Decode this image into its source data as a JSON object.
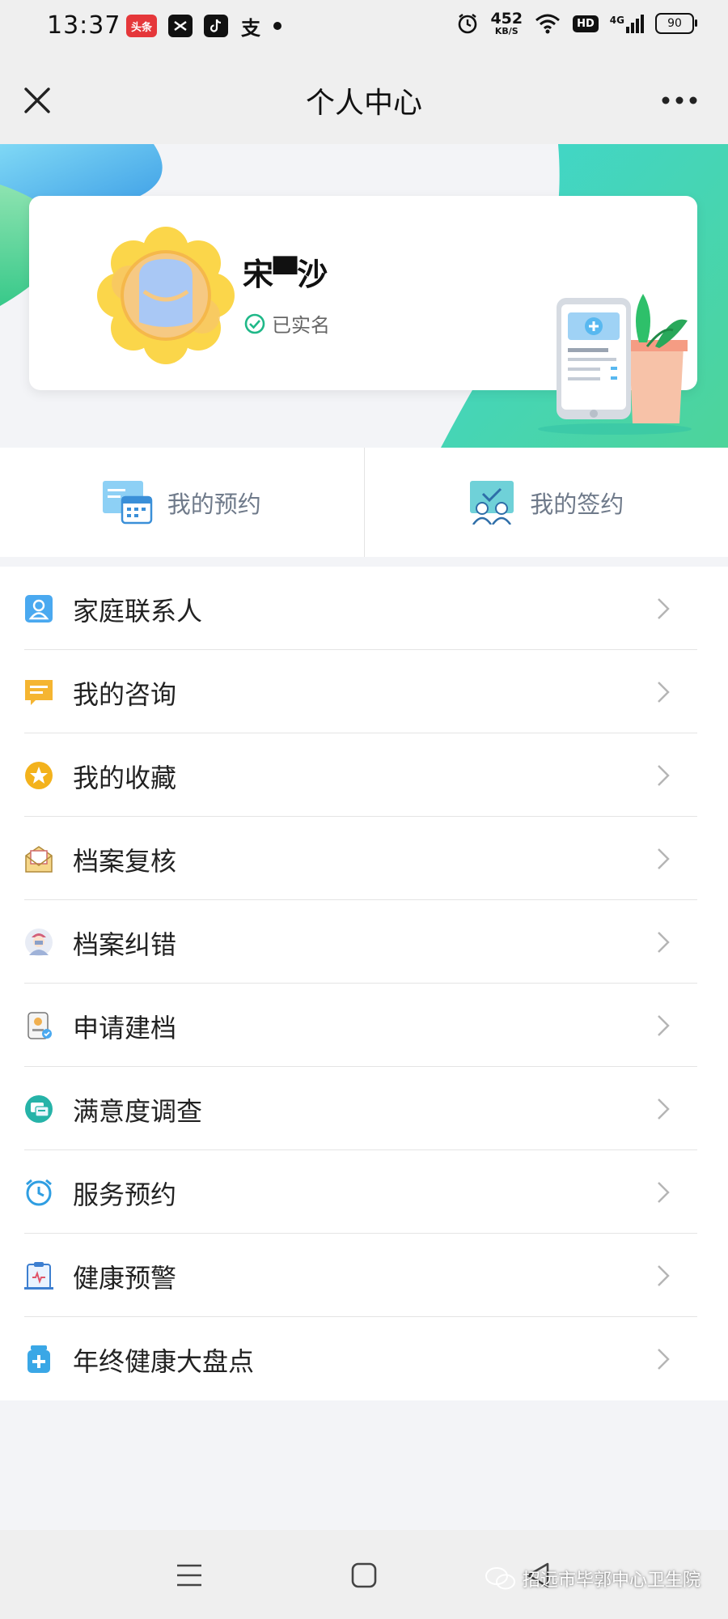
{
  "status_bar": {
    "time": "13:37",
    "apps": [
      "头条",
      "tiktok",
      "capcut",
      "支"
    ],
    "net_speed": "452",
    "net_unit": "KB/S",
    "hd": "HD",
    "signal": "4G",
    "battery": "90"
  },
  "header": {
    "title": "个人中心"
  },
  "profile": {
    "name": "宋▀沙",
    "verified_label": "已实名"
  },
  "quick_actions": [
    {
      "label": "我的预约",
      "icon": "calendar-icon"
    },
    {
      "label": "我的签约",
      "icon": "contract-icon"
    }
  ],
  "menu": [
    {
      "label": "家庭联系人",
      "icon": "contact-icon",
      "color": "#4aa9f0"
    },
    {
      "label": "我的咨询",
      "icon": "chat-icon",
      "color": "#f5b531"
    },
    {
      "label": "我的收藏",
      "icon": "star-icon",
      "color": "#f3b21c"
    },
    {
      "label": "档案复核",
      "icon": "envelope-icon",
      "color": "#f0c766"
    },
    {
      "label": "档案纠错",
      "icon": "doctor-icon",
      "color": "#8a9bc4"
    },
    {
      "label": "申请建档",
      "icon": "badge-icon",
      "color": "#e8a449"
    },
    {
      "label": "满意度调查",
      "icon": "survey-icon",
      "color": "#26b3a8"
    },
    {
      "label": "服务预约",
      "icon": "alarm-icon",
      "color": "#2f9ee2"
    },
    {
      "label": "健康预警",
      "icon": "clipboard-icon",
      "color": "#3d7fd0"
    },
    {
      "label": "年终健康大盘点",
      "icon": "medicine-icon",
      "color": "#3aa7e6"
    }
  ],
  "watermark": "招远市毕郭中心卫生院",
  "colors": {
    "accent_teal": "#3fd6d0",
    "accent_green": "#4dd49a",
    "text_gray": "#6f7a8a"
  }
}
